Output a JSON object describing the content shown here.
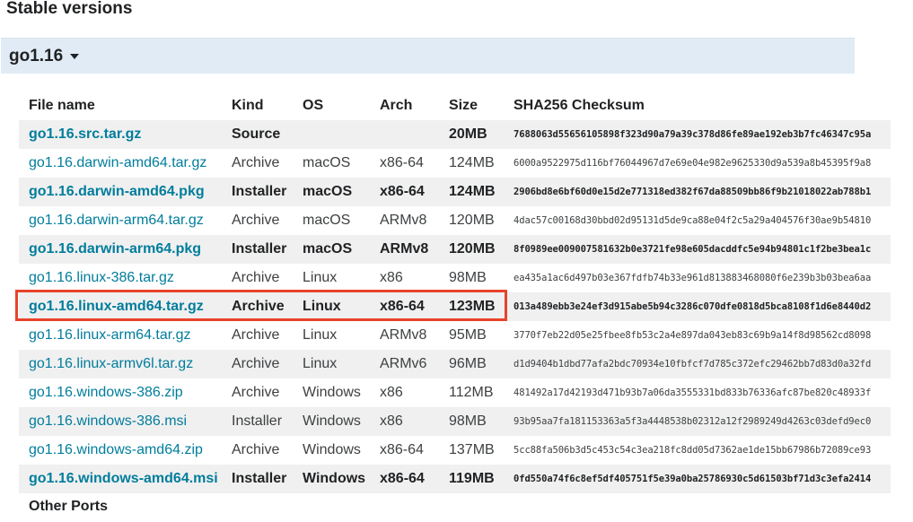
{
  "section_title": "Stable versions",
  "version": {
    "label": "go1.16"
  },
  "table": {
    "headers": [
      "File name",
      "Kind",
      "OS",
      "Arch",
      "Size",
      "SHA256 Checksum"
    ],
    "rows": [
      {
        "file": "go1.16.src.tar.gz",
        "kind": "Source",
        "os": "",
        "arch": "",
        "size": "20MB",
        "sha": "7688063d55656105898f323d90a79a39c378d86fe89ae192eb3b7fc46347c95a",
        "highlight": true
      },
      {
        "file": "go1.16.darwin-amd64.tar.gz",
        "kind": "Archive",
        "os": "macOS",
        "arch": "x86-64",
        "size": "124MB",
        "sha": "6000a9522975d116bf76044967d7e69e04e982e9625330d9a539a8b45395f9a8",
        "highlight": false
      },
      {
        "file": "go1.16.darwin-amd64.pkg",
        "kind": "Installer",
        "os": "macOS",
        "arch": "x86-64",
        "size": "124MB",
        "sha": "2906bd8e6bf60d0e15d2e771318ed382f67da88509bb86f9b21018022ab788b1",
        "highlight": true
      },
      {
        "file": "go1.16.darwin-arm64.tar.gz",
        "kind": "Archive",
        "os": "macOS",
        "arch": "ARMv8",
        "size": "120MB",
        "sha": "4dac57c00168d30bbd02d95131d5de9ca88e04f2c5a29a404576f30ae9b54810",
        "highlight": false
      },
      {
        "file": "go1.16.darwin-arm64.pkg",
        "kind": "Installer",
        "os": "macOS",
        "arch": "ARMv8",
        "size": "120MB",
        "sha": "8f0989ee009007581632b0e3721fe98e605dacddfc5e94b94801c1f2be3bea1c",
        "highlight": true
      },
      {
        "file": "go1.16.linux-386.tar.gz",
        "kind": "Archive",
        "os": "Linux",
        "arch": "x86",
        "size": "98MB",
        "sha": "ea435a1ac6d497b03e367fdfb74b33e961d813883468080f6e239b3b03bea6aa",
        "highlight": false
      },
      {
        "file": "go1.16.linux-amd64.tar.gz",
        "kind": "Archive",
        "os": "Linux",
        "arch": "x86-64",
        "size": "123MB",
        "sha": "013a489ebb3e24ef3d915abe5b94c3286c070dfe0818d5bca8108f1d6e8440d2",
        "highlight": true
      },
      {
        "file": "go1.16.linux-arm64.tar.gz",
        "kind": "Archive",
        "os": "Linux",
        "arch": "ARMv8",
        "size": "95MB",
        "sha": "3770f7eb22d05e25fbee8fb53c2a4e897da043eb83c69b9a14f8d98562cd8098",
        "highlight": false
      },
      {
        "file": "go1.16.linux-armv6l.tar.gz",
        "kind": "Archive",
        "os": "Linux",
        "arch": "ARMv6",
        "size": "96MB",
        "sha": "d1d9404b1dbd77afa2bdc70934e10fbfcf7d785c372efc29462bb7d83d0a32fd",
        "highlight": false
      },
      {
        "file": "go1.16.windows-386.zip",
        "kind": "Archive",
        "os": "Windows",
        "arch": "x86",
        "size": "112MB",
        "sha": "481492a17d42193d471b93b7a06da3555331bd833b76336afc87be820c48933f",
        "highlight": false
      },
      {
        "file": "go1.16.windows-386.msi",
        "kind": "Installer",
        "os": "Windows",
        "arch": "x86",
        "size": "98MB",
        "sha": "93b95aa7fa181153363a5f3a4448538b02312a12f2989249d4263c03defd9ec0",
        "highlight": false
      },
      {
        "file": "go1.16.windows-amd64.zip",
        "kind": "Archive",
        "os": "Windows",
        "arch": "x86-64",
        "size": "137MB",
        "sha": "5cc88fa506b3d5c453c54c3ea218fc8dd05d7362ae1de15bb67986b72089ce93",
        "highlight": false
      },
      {
        "file": "go1.16.windows-amd64.msi",
        "kind": "Installer",
        "os": "Windows",
        "arch": "x86-64",
        "size": "119MB",
        "sha": "0fd550a74f6c8ef5df405751f5e39a0ba25786930c5d61503bf71d3c3efa2414",
        "highlight": true
      }
    ]
  },
  "selection": {
    "row_file": "go1.16.linux-amd64.tar.gz"
  },
  "other_ports": "Other Ports",
  "colors": {
    "link": "#007d9c",
    "version_bar": "#e0ebf5",
    "row_stripe": "#f0f0f0",
    "selection_border": "#e8432b"
  }
}
